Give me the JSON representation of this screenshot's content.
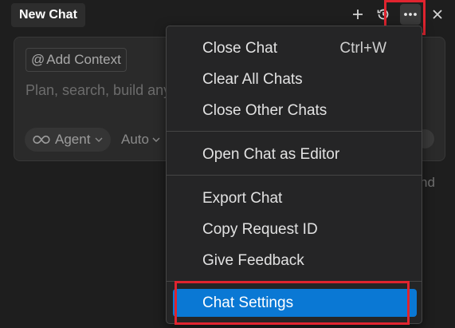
{
  "header": {
    "tab_title": "New Chat",
    "icons": [
      "plus-icon",
      "history-icon",
      "more-icon",
      "close-icon"
    ]
  },
  "composer": {
    "context_chip": "Add Context",
    "placeholder": "Plan, search, build any",
    "mode": "Agent",
    "model": "Auto",
    "behind_menu_text": "nd"
  },
  "menu": {
    "items": [
      {
        "label": "Close Chat",
        "shortcut": "Ctrl+W"
      },
      {
        "label": "Clear All Chats"
      },
      {
        "label": "Close Other Chats"
      },
      {
        "label": "Open Chat as Editor"
      },
      {
        "label": "Export Chat"
      },
      {
        "label": "Copy Request ID"
      },
      {
        "label": "Give Feedback"
      },
      {
        "label": "Chat Settings",
        "active": true
      }
    ]
  },
  "colors": {
    "background": "#1e1e1e",
    "menu_bg": "#252526",
    "active_item": "#0a78d4",
    "highlight_border": "#e0242f"
  }
}
